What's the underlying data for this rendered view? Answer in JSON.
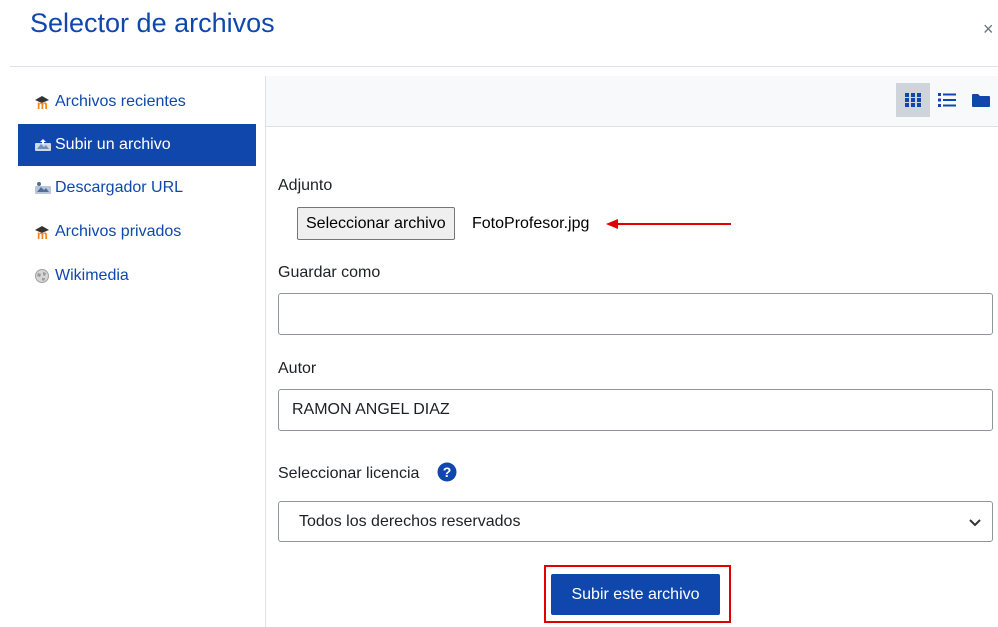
{
  "dialog": {
    "title": "Selector de archivos",
    "close_glyph": "×"
  },
  "sidebar": {
    "items": [
      {
        "label": "Archivos recientes",
        "icon": "moodle-icon",
        "active": false
      },
      {
        "label": "Subir un archivo",
        "icon": "upload-icon",
        "active": true
      },
      {
        "label": "Descargador URL",
        "icon": "url-download-icon",
        "active": false
      },
      {
        "label": "Archivos privados",
        "icon": "moodle-icon",
        "active": false
      },
      {
        "label": "Wikimedia",
        "icon": "wikimedia-icon",
        "active": false
      }
    ]
  },
  "toolbar": {
    "views": [
      "grid-view-icon",
      "list-view-icon",
      "folder-view-icon"
    ],
    "active_view": "grid-view-icon"
  },
  "form": {
    "attachment_label": "Adjunto",
    "choose_file_button": "Seleccionar archivo",
    "chosen_file": "FotoProfesor.jpg",
    "save_as_label": "Guardar como",
    "save_as_value": "",
    "author_label": "Autor",
    "author_value": "RAMON ANGEL DIAZ",
    "license_label": "Seleccionar licencia",
    "license_value": "Todos los derechos reservados",
    "submit_label": "Subir este archivo"
  },
  "colors": {
    "brand": "#0f47ad",
    "annotation": "#e00000"
  }
}
